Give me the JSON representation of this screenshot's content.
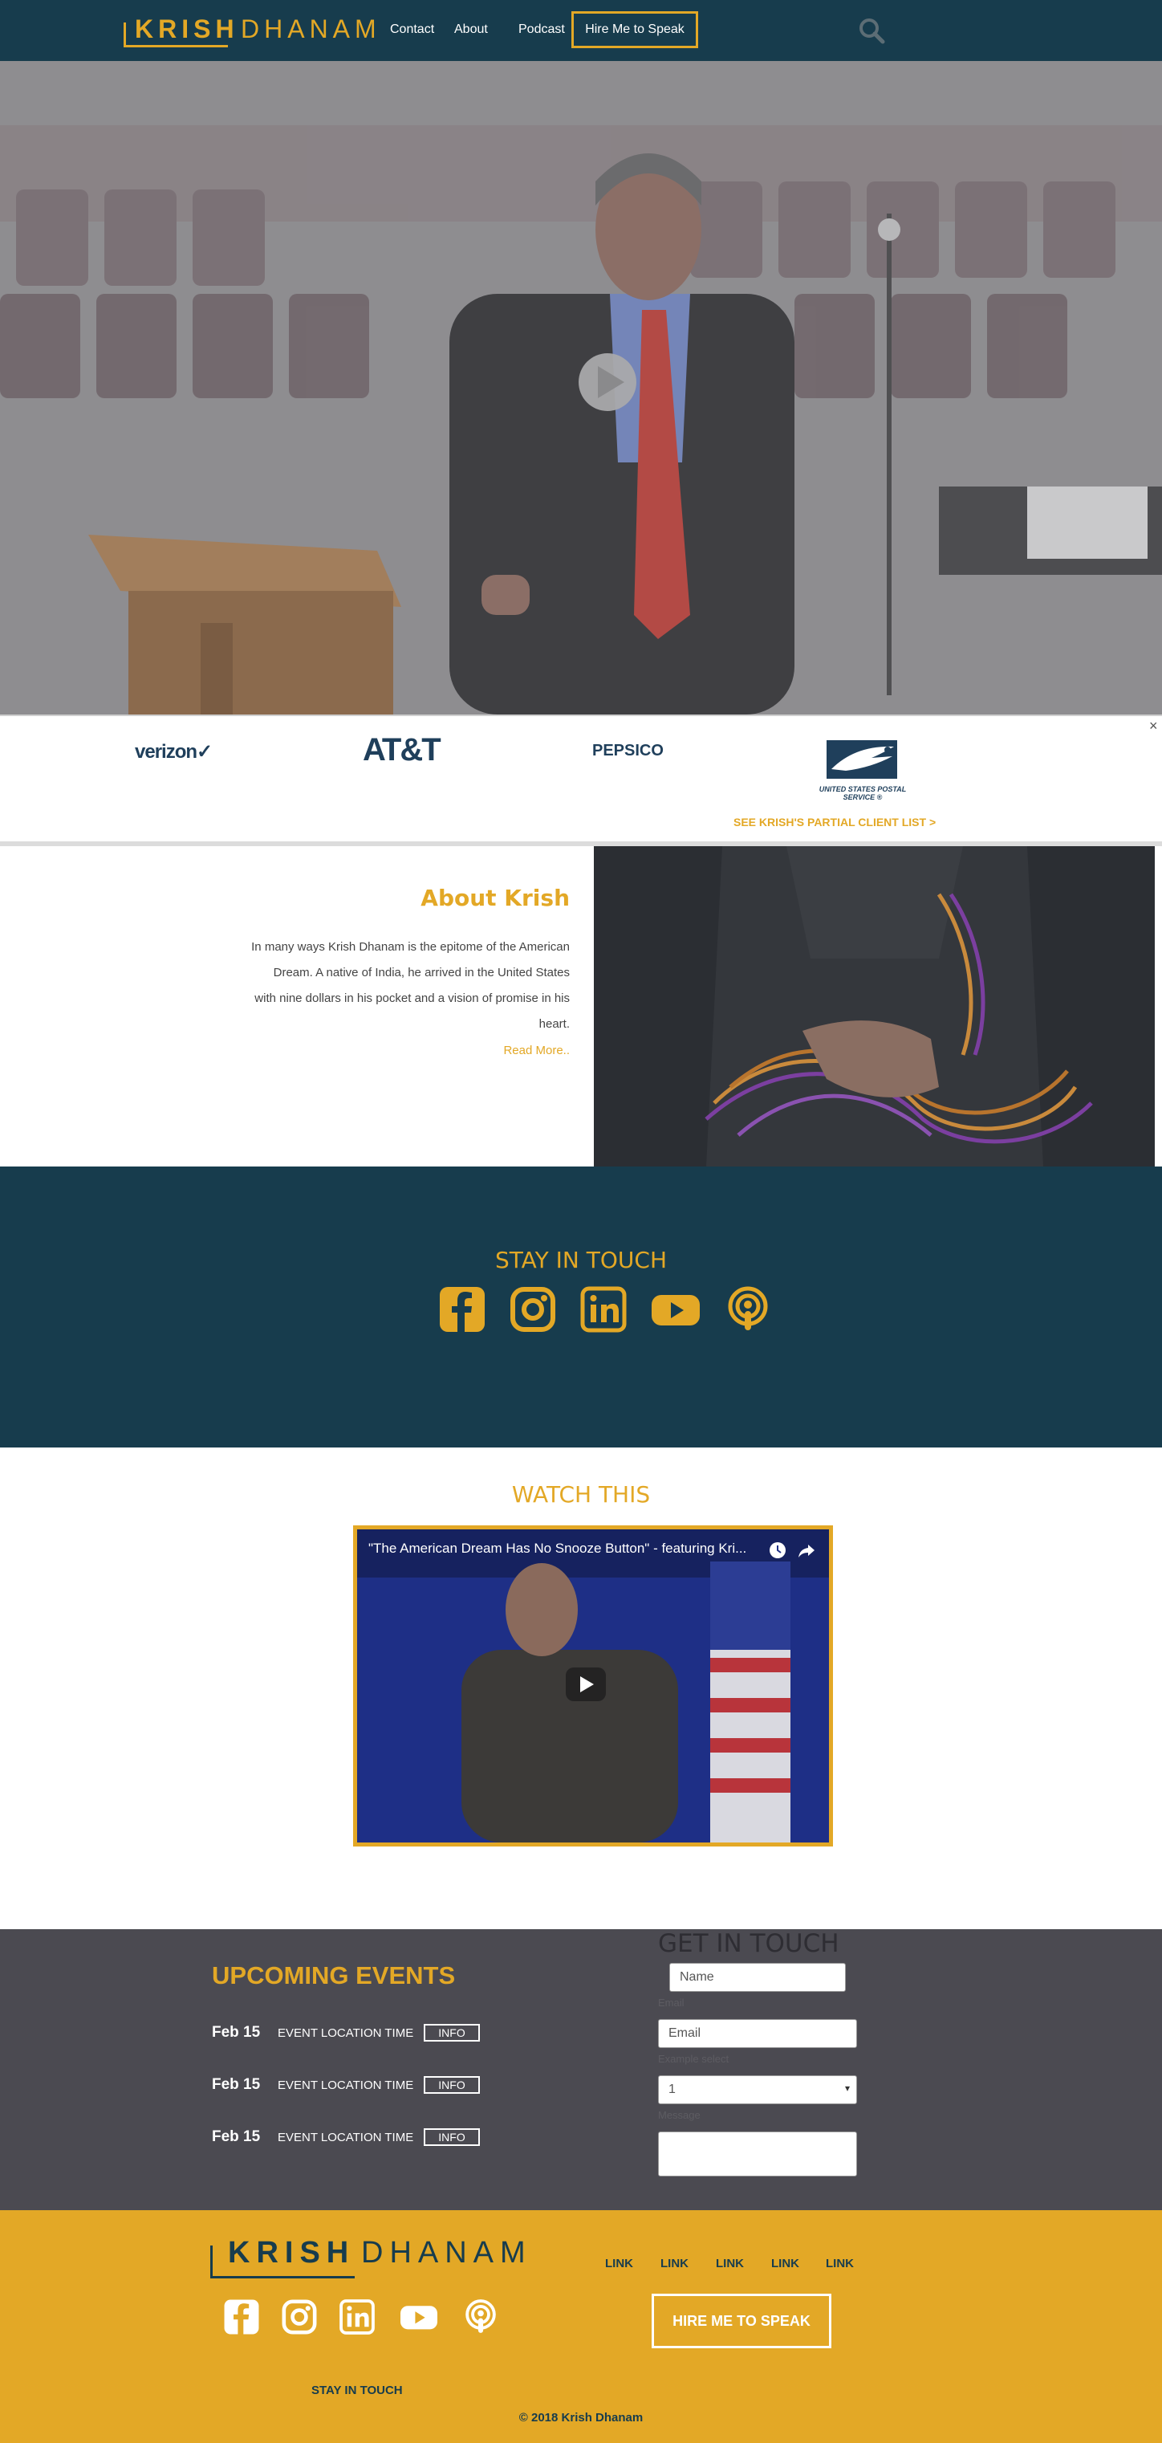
{
  "nav": {
    "logo_bold": "KRISH",
    "logo_light": "DHANAM",
    "links": [
      "Contact",
      "About",
      "Podcast"
    ],
    "hire_label": "Hire Me to Speak"
  },
  "clients": {
    "logos": [
      "verizon✓",
      "AT&T",
      "PEPSICO",
      "UNITED STATES POSTAL SERVICE ®"
    ],
    "link_label": "SEE KRISH'S PARTIAL CLIENT LIST >",
    "close_label": "×"
  },
  "about": {
    "title": "About Krish",
    "text": "In many ways Krish Dhanam is the epitome of the American Dream. A native of India, he arrived in the United States with nine dollars in his pocket and a vision of promise in his heart.",
    "read_more": "Read More.."
  },
  "stay": {
    "title": "STAY IN TOUCH",
    "icons": [
      "facebook-icon",
      "instagram-icon",
      "linkedin-icon",
      "youtube-icon",
      "podcast-icon"
    ]
  },
  "watch": {
    "title": "WATCH THIS",
    "video_title": "\"The American Dream Has No Snooze Button\" - featuring Kri..."
  },
  "events": {
    "title": "UPCOMING EVENTS",
    "items": [
      {
        "date": "Feb 15",
        "location": "EVENT LOCATION TIME",
        "info": "INFO"
      },
      {
        "date": "Feb 15",
        "location": "EVENT LOCATION TIME",
        "info": "INFO"
      },
      {
        "date": "Feb 15",
        "location": "EVENT LOCATION TIME",
        "info": "INFO"
      }
    ]
  },
  "contact": {
    "title": "GET IN TOUCH",
    "name_placeholder": "Name",
    "email_label": "Email",
    "email_placeholder": "Email",
    "select_label": "Example select",
    "select_value": "1",
    "message_label": "Message"
  },
  "footer": {
    "logo_bold": "KRISH",
    "logo_light": "DHANAM",
    "links": [
      "LINK",
      "LINK",
      "LINK",
      "LINK",
      "LINK"
    ],
    "hire_label": "HIRE ME TO SPEAK",
    "stay_label": "STAY IN TOUCH",
    "copyright": "© 2018 Krish Dhanam"
  },
  "colors": {
    "navy": "#173c4d",
    "gold": "#e3a826",
    "charcoal": "#4b4a51"
  }
}
